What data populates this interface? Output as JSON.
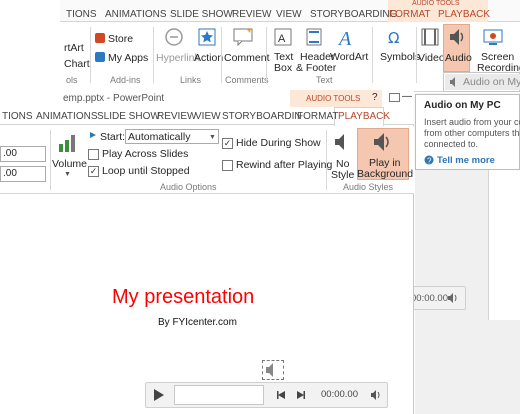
{
  "back_window": {
    "tabs": [
      "TIONS",
      "ANIMATIONS",
      "SLIDE SHOW",
      "REVIEW",
      "VIEW",
      "STORYBOARDING",
      "FORMAT",
      "PLAYBACK"
    ],
    "context_tools_label": "AUDIO TOOLS",
    "store_label": "Store",
    "myapps_label": "My Apps",
    "smartart_label": "rtArt",
    "chart_label": "Chart",
    "addins_group": "Add-ins",
    "hyperlink_label": "Hyperlink",
    "action_label": "Action",
    "links_group": "Links",
    "comment_label": "Comment",
    "comments_group": "Comments",
    "textbox_label": [
      "Text",
      "Box"
    ],
    "header_label": [
      "Header",
      "& Footer"
    ],
    "wordart_label": "WordArt",
    "text_group": "Text",
    "symbols_label": "Symbols",
    "video_label": "Video",
    "audio_label": "Audio",
    "screen_label": [
      "Screen",
      "Recording"
    ],
    "left_group": "ols",
    "audio_dropdown_item": "Audio on My PC"
  },
  "tooltip": {
    "title": "Audio on My PC",
    "body": [
      "Insert audio from your com",
      "from other computers that",
      "connected to."
    ],
    "help": "Tell me more"
  },
  "front_window": {
    "title": "emp.pptx - PowerPoint",
    "context_tools_label": "AUDIO TOOLS",
    "window_buttons": [
      "?",
      "—"
    ],
    "tabs": [
      "TIONS",
      "ANIMATIONS",
      "SLIDE SHOW",
      "REVIEW",
      "VIEW",
      "STORYBOARDIN",
      "FORMAT",
      "PLAYBACK"
    ],
    "spin1": ".00",
    "spin2": ".00",
    "volume_label": "Volume",
    "start_label": "Start:",
    "start_value": "Automatically",
    "play_across": "Play Across Slides",
    "loop": "Loop until Stopped",
    "hide": "Hide During Show",
    "rewind": "Rewind after Playing",
    "audio_options_group": "Audio Options",
    "no_style": [
      "No",
      "Style"
    ],
    "play_bg": [
      "Play in",
      "Background"
    ],
    "audio_styles_group": "Audio Styles"
  },
  "slide": {
    "title": "My presentation",
    "subtitle": "By FYIcenter.com",
    "player_time": "00:00.00"
  },
  "right_player": {
    "time": "00:00.00"
  },
  "colors": {
    "accent": "#b7472a",
    "title_red": "#ff0000",
    "highlight": "#f5c6b0",
    "link_blue": "#2e75b6"
  }
}
